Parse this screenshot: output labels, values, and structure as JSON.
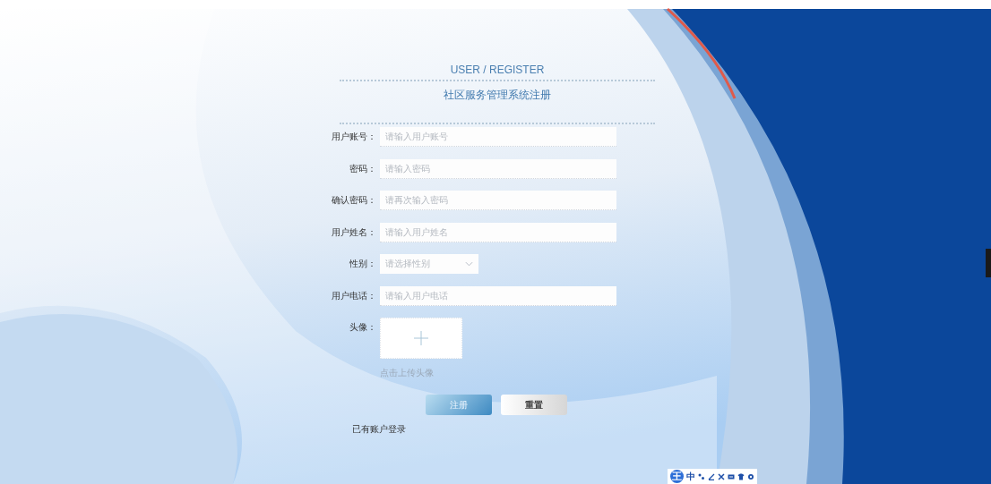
{
  "header": {
    "subtitle": "USER / REGISTER",
    "title": "社区服务管理系统注册"
  },
  "fields": [
    {
      "kind": "input",
      "label": "用户账号：",
      "placeholder": "请输入用户账号"
    },
    {
      "kind": "input",
      "label": "密码：",
      "placeholder": "请输入密码"
    },
    {
      "kind": "input",
      "label": "确认密码：",
      "placeholder": "请再次输入密码"
    },
    {
      "kind": "input",
      "label": "用户姓名：",
      "placeholder": "请输入用户姓名"
    },
    {
      "kind": "select",
      "label": "性别：",
      "placeholder": "请选择性别"
    },
    {
      "kind": "input",
      "label": "用户电话：",
      "placeholder": "请输入用户电话"
    },
    {
      "kind": "upload",
      "label": "头像：",
      "hint": "点击上传头像"
    }
  ],
  "buttons": [
    {
      "kind": "primary",
      "label": "注册"
    },
    {
      "kind": "secondary",
      "label": "重置"
    }
  ],
  "login_link": "已有账户登录",
  "ime_toolbar": {
    "logo": "王",
    "mode": "中"
  }
}
